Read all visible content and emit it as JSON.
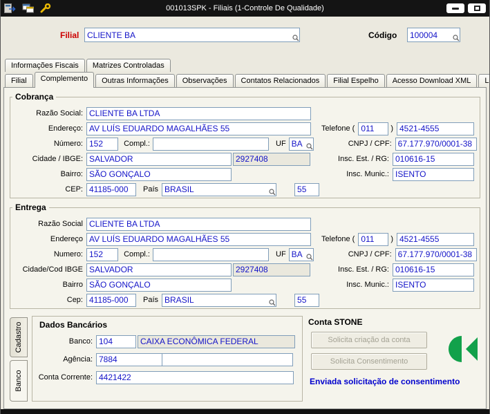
{
  "titlebar": {
    "title": "001013SPK - Filiais (1-Controle De Qualidade)"
  },
  "header": {
    "filial_label": "Filial",
    "filial_value": "CLIENTE BA",
    "codigo_label": "Código",
    "codigo_value": "100004"
  },
  "tabs_row1": [
    {
      "label": "Informações Fiscais"
    },
    {
      "label": "Matrizes Controladas"
    }
  ],
  "tabs_row2": [
    {
      "label": "Filial"
    },
    {
      "label": "Complemento"
    },
    {
      "label": "Outras Informações"
    },
    {
      "label": "Observações"
    },
    {
      "label": "Contatos Relacionados"
    },
    {
      "label": "Filial Espelho"
    },
    {
      "label": "Acesso Download XML"
    },
    {
      "label": "Log"
    }
  ],
  "active_tab": "Complemento",
  "cobranca": {
    "title": "Cobrança",
    "razao_social_label": "Razão Social:",
    "razao_social": "CLIENTE BA LTDA",
    "endereco_label": "Endereço:",
    "endereco": "AV LUÍS EDUARDO MAGALHÃES 55",
    "telefone_label": "Telefone (",
    "telefone_ddd": "011",
    "telefone_close": ")",
    "telefone_numero": "4521-4555",
    "numero_label": "Número:",
    "numero": "152",
    "compl_label": "Compl.:",
    "compl": "",
    "uf_label": "UF",
    "uf": "BA",
    "cnpj_label": "CNPJ / CPF:",
    "cnpj": "67.177.970/0001-38",
    "cidade_label": "Cidade / IBGE:",
    "cidade": "SALVADOR",
    "ibge": "2927408",
    "insc_est_label": "Insc. Est. / RG:",
    "insc_est": "010616-15",
    "bairro_label": "Bairro:",
    "bairro": "SÃO GONÇALO",
    "insc_mun_label": "Insc. Munic.:",
    "insc_mun": "ISENTO",
    "cep_label": "CEP:",
    "cep": "41185-000",
    "pais_label": "País",
    "pais": "BRASIL",
    "pais_codigo": "55"
  },
  "entrega": {
    "title": "Entrega",
    "razao_social_label": "Razão Social",
    "razao_social": "CLIENTE BA LTDA",
    "endereco_label": "Endereço",
    "endereco": "AV LUÍS EDUARDO MAGALHÃES 55",
    "telefone_label": "Telefone (",
    "telefone_ddd": "011",
    "telefone_close": ")",
    "telefone_numero": "4521-4555",
    "numero_label": "Numero:",
    "numero": "152",
    "compl_label": "Compl.:",
    "compl": "",
    "uf_label": "UF",
    "uf": "BA",
    "cnpj_label": "CNPJ / CPF:",
    "cnpj": "67.177.970/0001-38",
    "cidade_label": "Cidade/Cod IBGE",
    "cidade": "SALVADOR",
    "ibge": "2927408",
    "insc_est_label": "Insc. Est. / RG:",
    "insc_est": "010616-15",
    "bairro_label": "Bairro",
    "bairro": "SÃO GONÇALO",
    "insc_mun_label": "Insc. Munic.:",
    "insc_mun": "ISENTO",
    "cep_label": "Cep:",
    "cep": "41185-000",
    "pais_label": "País",
    "pais": "BRASIL",
    "pais_codigo": "55"
  },
  "side_tabs": [
    {
      "label": "Cadastro"
    },
    {
      "label": "Banco"
    }
  ],
  "dados_bancarios": {
    "title": "Dados Bancários",
    "banco_label": "Banco:",
    "banco_codigo": "104",
    "banco_nome": "CAIXA ECONÔMICA FEDERAL",
    "agencia_label": "Agência:",
    "agencia": "7884",
    "agencia_extra": "",
    "conta_label": "Conta Corrente:",
    "conta": "4421422"
  },
  "conta_stone": {
    "title": "Conta STONE",
    "botao_criacao": "Solicita criação da conta",
    "botao_consentimento": "Solicita Consentimento",
    "status": "Enviada solicitação de consentimento"
  },
  "colors": {
    "titlebar_bg": "#141414",
    "field_text": "#1414C8",
    "filial_label_color": "#CC0000",
    "status_color": "#0000CD",
    "stone_green": "#12A14B",
    "disabled_button_text": "#A3A193"
  }
}
